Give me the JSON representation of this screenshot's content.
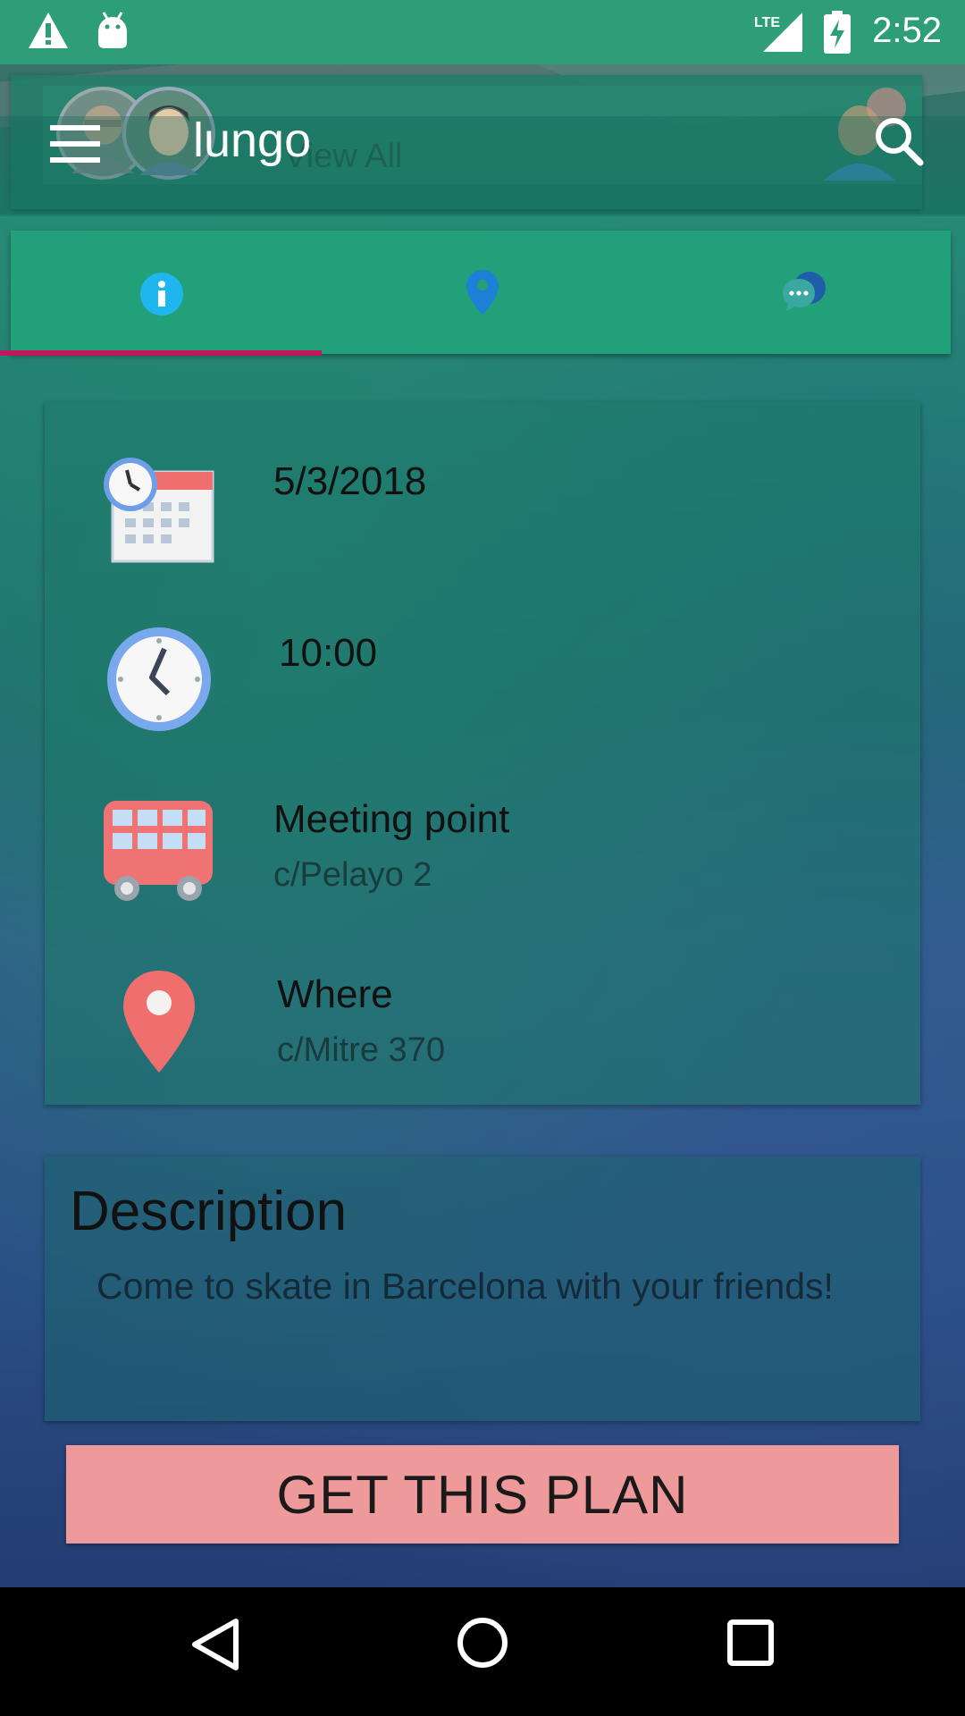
{
  "status_bar": {
    "time": "2:52",
    "network": "LTE",
    "icons": [
      "warning-icon",
      "android-icon",
      "lte-signal-icon",
      "battery-charging-icon"
    ]
  },
  "background": {
    "view_all_label": "View All"
  },
  "app_bar": {
    "title": "lungo",
    "menu_icon": "menu-icon",
    "search_icon": "search-icon"
  },
  "tabs": [
    {
      "name": "info",
      "icon": "info-icon",
      "selected": true
    },
    {
      "name": "location",
      "icon": "map-pin-icon",
      "selected": false
    },
    {
      "name": "chat",
      "icon": "chat-icon",
      "selected": false
    }
  ],
  "details": {
    "date": "5/3/2018",
    "time": "10:00",
    "meeting_point_label": "Meeting point",
    "meeting_point_value": "c/Pelayo 2",
    "where_label": "Where",
    "where_value": "c/Mitre 370"
  },
  "description": {
    "title": "Description",
    "text": "Come to skate in Barcelona with your friends!"
  },
  "cta": {
    "label": "GET THIS PLAN"
  },
  "colors": {
    "accent": "#c2185b",
    "tab_bar": "#21a07a",
    "cta_bg": "#ef9a9a",
    "status_bar": "#2e9e79"
  }
}
